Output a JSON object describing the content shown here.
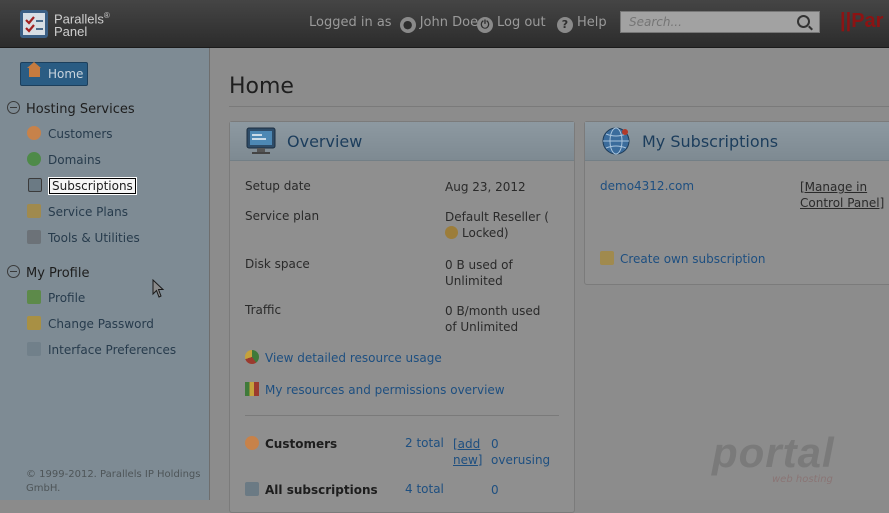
{
  "header": {
    "logo_name": "Parallels",
    "logo_reg": "®",
    "logo_product": "Panel",
    "logged_in_label": "Logged in as",
    "user_name": "John Doe",
    "logout_label": "Log out",
    "help_label": "Help",
    "search_placeholder": "Search...",
    "brand_partial": "||Par"
  },
  "sidebar": {
    "home_label": "Home",
    "sections": [
      {
        "title": "Hosting Services",
        "items": [
          {
            "label": "Customers",
            "icon": "person-icon"
          },
          {
            "label": "Domains",
            "icon": "globe-icon"
          },
          {
            "label": "Subscriptions",
            "icon": "subscription-icon",
            "selected": true
          },
          {
            "label": "Service Plans",
            "icon": "service-plan-icon"
          },
          {
            "label": "Tools & Utilities",
            "icon": "tools-icon"
          }
        ]
      },
      {
        "title": "My Profile",
        "items": [
          {
            "label": "Profile",
            "icon": "profile-card-icon"
          },
          {
            "label": "Change Password",
            "icon": "keys-icon"
          },
          {
            "label": "Interface Preferences",
            "icon": "preferences-icon"
          }
        ]
      }
    ],
    "copyright": "© 1999-2012. Parallels IP Holdings GmbH."
  },
  "main": {
    "title": "Home",
    "overview": {
      "title": "Overview",
      "rows": [
        {
          "label": "Setup date",
          "value": "Aug 23, 2012"
        },
        {
          "label": "Service plan",
          "value": "Default Reseller (",
          "value2": "Locked)"
        },
        {
          "label": "Disk space",
          "value": "0 B used of Unlimited"
        },
        {
          "label": "Traffic",
          "value": "0 B/month used of Unlimited"
        }
      ],
      "links": [
        {
          "label": "View detailed resource usage"
        },
        {
          "label": "My resources and permissions overview"
        }
      ],
      "stats": [
        {
          "label": "Customers",
          "count": "2 total",
          "action": "[add new]",
          "extra": "0 overusing"
        },
        {
          "label": "All subscriptions",
          "count": "4 total",
          "extra": "0"
        }
      ]
    },
    "subscriptions": {
      "title": "My Subscriptions",
      "domain": "demo4312.com",
      "manage": "[Manage in Control Panel]",
      "create": "Create own subscription"
    }
  },
  "watermark": {
    "text": "portal",
    "sub": "web hosting"
  }
}
